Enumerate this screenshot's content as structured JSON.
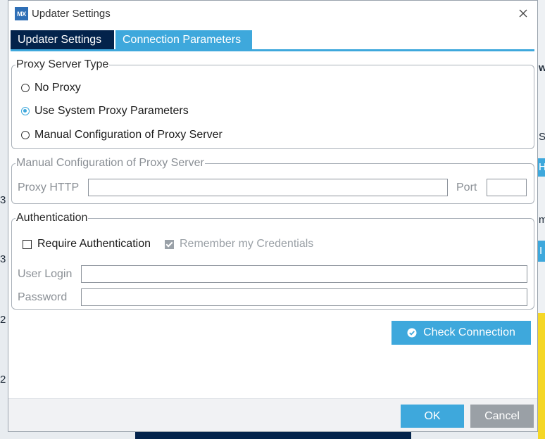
{
  "window": {
    "app_icon_text": "MX",
    "title": "Updater Settings"
  },
  "tabs": [
    {
      "label": "Updater Settings",
      "active": false
    },
    {
      "label": "Connection Parameters",
      "active": true
    }
  ],
  "proxy_type": {
    "legend": "Proxy Server Type",
    "options": [
      {
        "label": "No Proxy",
        "selected": false
      },
      {
        "label": "Use System Proxy Parameters",
        "selected": true
      },
      {
        "label": "Manual Configuration of Proxy Server",
        "selected": false
      }
    ]
  },
  "manual_config": {
    "legend": "Manual Configuration of Proxy Server",
    "proxy_http_label": "Proxy HTTP",
    "proxy_http_value": "",
    "port_label": "Port",
    "port_value": ""
  },
  "authentication": {
    "legend": "Authentication",
    "require_label": "Require Authentication",
    "require_checked": false,
    "remember_label": "Remember my Credentials",
    "remember_checked": true,
    "user_login_label": "User Login",
    "user_login_value": "",
    "password_label": "Password",
    "password_value": ""
  },
  "actions": {
    "check_connection": "Check Connection",
    "ok": "OK",
    "cancel": "Cancel"
  },
  "background_fragments": {
    "right_letters": [
      "w",
      "S",
      "H",
      "m",
      "I"
    ],
    "left_digits": [
      "3",
      "3",
      "2",
      "2"
    ]
  },
  "colors": {
    "accent": "#3ea8dc",
    "tab_dark": "#03234b",
    "button_gray": "#9aa0a6"
  }
}
